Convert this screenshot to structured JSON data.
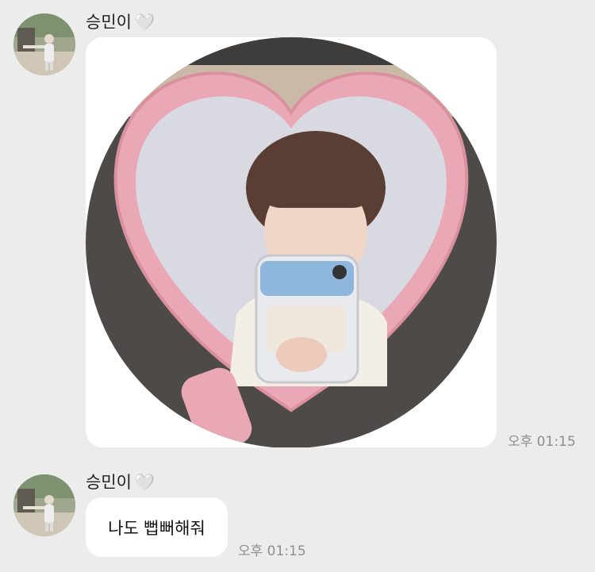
{
  "messages": [
    {
      "sender": "승민이",
      "sender_badge": "🤍",
      "type": "image",
      "image_description_icon": "photo-icon",
      "time": "오후 01:15"
    },
    {
      "sender": "승민이",
      "sender_badge": "🤍",
      "type": "text",
      "text": "나도 뻡뻐해줘",
      "time": "오후 01:15"
    }
  ],
  "colors": {
    "background": "#ececec",
    "bubble": "#ffffff",
    "time_text": "#8e8e8e",
    "mirror_frame": "#e9a5b3"
  }
}
